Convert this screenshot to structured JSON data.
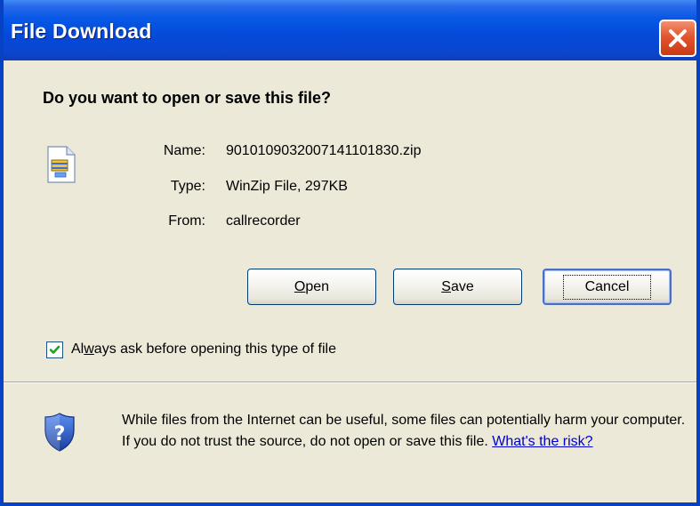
{
  "window": {
    "title": "File Download",
    "close_icon": "close-icon"
  },
  "prompt": {
    "question": "Do you want to open or save this file?"
  },
  "file": {
    "icon": "zip-file-icon",
    "name_label": "Name:",
    "name_value": "9010109032007141101830.zip",
    "type_label": "Type:",
    "type_value": "WinZip File, 297KB",
    "from_label": "From:",
    "from_value": "callrecorder"
  },
  "buttons": {
    "open": {
      "label_prefix": "",
      "label_accel": "O",
      "label_rest": "pen"
    },
    "save": {
      "label_prefix": "",
      "label_accel": "S",
      "label_rest": "ave"
    },
    "cancel": {
      "label": "Cancel"
    }
  },
  "checkbox": {
    "checked": true,
    "label_prefix": "Al",
    "label_accel": "w",
    "label_rest": "ays ask before opening this type of file"
  },
  "warning": {
    "icon": "shield-question-icon",
    "text": "While files from the Internet can be useful, some files can potentially harm your computer. If you do not trust the source, do not open or save this file. ",
    "link": "What's the risk?"
  },
  "colors": {
    "titlebar": "#0758e6",
    "dialog_bg": "#ece9d8",
    "close_button": "#e3552e",
    "link": "#0000cc"
  }
}
